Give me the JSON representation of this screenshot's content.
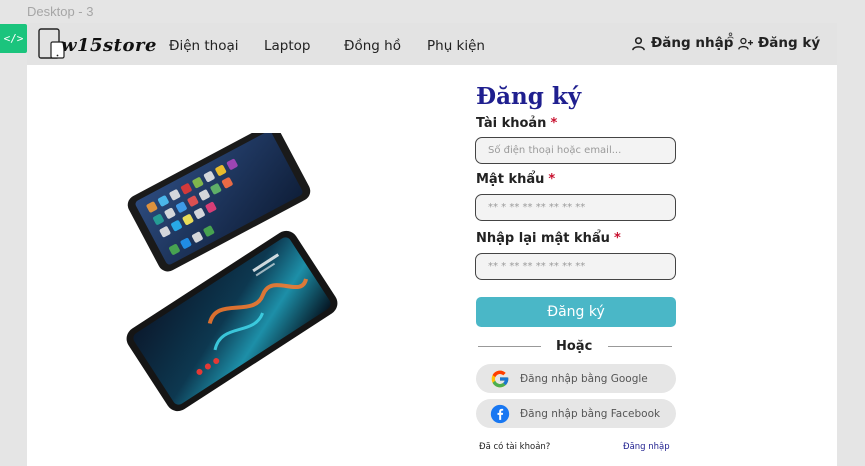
{
  "frame": {
    "label": "Desktop - 3"
  },
  "code_badge": "</>",
  "navbar": {
    "brand": "w15store",
    "links": [
      "Điện thoại",
      "Laptop",
      "Đồng hồ",
      "Phụ kiện"
    ],
    "login_label": "Đăng nhập",
    "register_label": "Đăng ký"
  },
  "form": {
    "title": "Đăng ký",
    "account_label": "Tài khoản",
    "account_placeholder": "Số điện thoại hoặc email...",
    "password_label": "Mật khẩu",
    "password_value": "** * ** ** ** ** ** **",
    "confirm_label": "Nhập lại mật khẩu",
    "confirm_value": "** * ** ** ** ** ** **",
    "required_mark": "*",
    "submit_label": "Đăng ký",
    "or_label": "Hoặc",
    "google_label": "Đăng nhập bằng Google",
    "facebook_label": "Đăng nhập bằng Facebook",
    "have_account_text": "Đã có tài khoản?",
    "login_link": "Đăng nhập"
  },
  "colors": {
    "title": "#1f1f8f",
    "submit": "#4ab7c7",
    "required": "#c8102e",
    "badge": "#1bc47d"
  },
  "icons": [
    "user-icon",
    "user-plus-icon",
    "google-icon",
    "facebook-icon",
    "code-icon",
    "phone-tablet-logo-icon"
  ]
}
